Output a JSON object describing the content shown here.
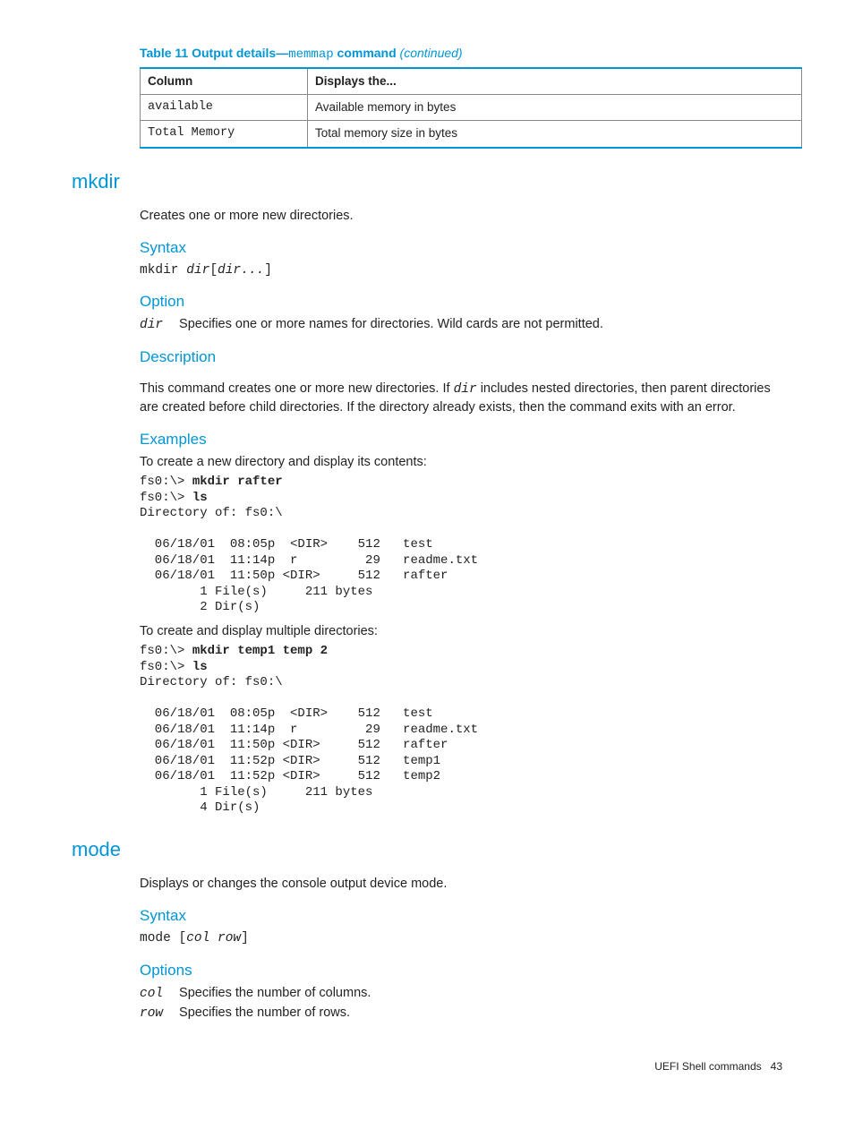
{
  "table": {
    "caption_prefix": "Table 11 Output details—",
    "caption_mono": "memmap",
    "caption_bold2": " command ",
    "caption_italic": "(continued)",
    "headers": [
      "Column",
      "Displays the..."
    ],
    "rows": [
      {
        "c1": "available",
        "c2": "Available memory in bytes"
      },
      {
        "c1": "Total Memory",
        "c2": "Total memory size in bytes"
      }
    ]
  },
  "mkdir": {
    "heading": "mkdir",
    "intro": "Creates one or more new directories.",
    "syntax_h": "Syntax",
    "syntax_cmd": "mkdir ",
    "syntax_arg1": "dir",
    "syntax_bracket_open": "[",
    "syntax_arg2": "dir...",
    "syntax_bracket_close": "]",
    "option_h": "Option",
    "option_term": "dir",
    "option_desc": "Specifies one or more names for directories. Wild cards are not permitted.",
    "desc_h": "Description",
    "desc_text1": "This command creates one or more new directories. If ",
    "desc_mono": "dir",
    "desc_text2": " includes nested directories, then parent directories are created before child directories. If the directory already exists, then the command exits with an error.",
    "examples_h": "Examples",
    "ex1_intro": "To create a new directory and display its contents:",
    "ex1_l1a": "fs0:\\> ",
    "ex1_l1b": "mkdir rafter",
    "ex1_l2a": "fs0:\\> ",
    "ex1_l2b": "ls",
    "ex1_l3": "Directory of: fs0:\\",
    "ex1_l4": "",
    "ex1_l5": "  06/18/01  08:05p  <DIR>    512   test",
    "ex1_l6": "  06/18/01  11:14p  r         29   readme.txt",
    "ex1_l7": "  06/18/01  11:50p <DIR>     512   rafter",
    "ex1_l8": "        1 File(s)     211 bytes",
    "ex1_l9": "        2 Dir(s)",
    "ex2_intro": "To create and display multiple directories:",
    "ex2_l1a": "fs0:\\> ",
    "ex2_l1b": "mkdir temp1 temp 2",
    "ex2_l2a": "fs0:\\> ",
    "ex2_l2b": "ls",
    "ex2_l3": "Directory of: fs0:\\",
    "ex2_l4": "",
    "ex2_l5": "  06/18/01  08:05p  <DIR>    512   test",
    "ex2_l6": "  06/18/01  11:14p  r         29   readme.txt",
    "ex2_l7": "  06/18/01  11:50p <DIR>     512   rafter",
    "ex2_l8": "  06/18/01  11:52p <DIR>     512   temp1",
    "ex2_l9": "  06/18/01  11:52p <DIR>     512   temp2",
    "ex2_l10": "        1 File(s)     211 bytes",
    "ex2_l11": "        4 Dir(s)"
  },
  "mode": {
    "heading": "mode",
    "intro": "Displays or changes the console output device mode.",
    "syntax_h": "Syntax",
    "syntax_cmd": "mode ",
    "syntax_bracket_open": "[",
    "syntax_arg": "col row",
    "syntax_bracket_close": "]",
    "options_h": "Options",
    "opt1_term": "col",
    "opt1_desc": "Specifies the number of columns.",
    "opt2_term": "row",
    "opt2_desc": "Specifies the number of rows."
  },
  "footer": {
    "text": "UEFI Shell commands",
    "page": "43"
  }
}
